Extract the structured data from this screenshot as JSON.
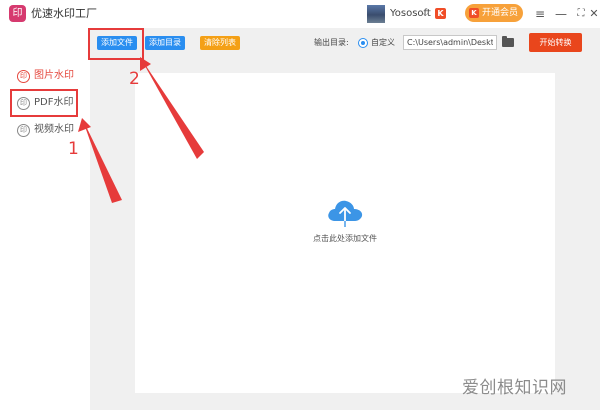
{
  "app": {
    "logo_glyph": "印",
    "title": "优速水印工厂",
    "username": "Yososoft",
    "user_chevron": "⌵",
    "vip_badge": "K",
    "member_label": "开通会员",
    "member_crown": "K"
  },
  "window_controls": {
    "menu_icon": "≡",
    "minimize_icon": "—",
    "maximize_icon": "⛶",
    "close_icon": "✕"
  },
  "sidebar": {
    "items": [
      {
        "icon_glyph": "印",
        "label": "图片水印",
        "active": true
      },
      {
        "icon_glyph": "印",
        "label": "PDF水印",
        "active": false
      },
      {
        "icon_glyph": "印",
        "label": "视频水印",
        "active": false
      }
    ]
  },
  "toolbar": {
    "add_file": "添加文件",
    "add_folder": "添加目录",
    "clear_list": "清除列表",
    "output_label": "输出目录:",
    "radio_label": "自定义",
    "output_path": "C:\\Users\\admin\\Deskto",
    "start_label": "开始转换"
  },
  "dropzone": {
    "hint": "点击此处添加文件"
  },
  "annotations": {
    "step1": "1",
    "step2": "2"
  },
  "watermark": "爱创根知识网",
  "colors": {
    "accent_red": "#e9461c",
    "button_blue": "#2a8ef0",
    "button_orange": "#f4a016",
    "member_orange": "#f7a13a",
    "annotation_red": "#e63b3b",
    "sidebar_active": "#e5483e",
    "cloud_blue": "#3c95e6"
  }
}
